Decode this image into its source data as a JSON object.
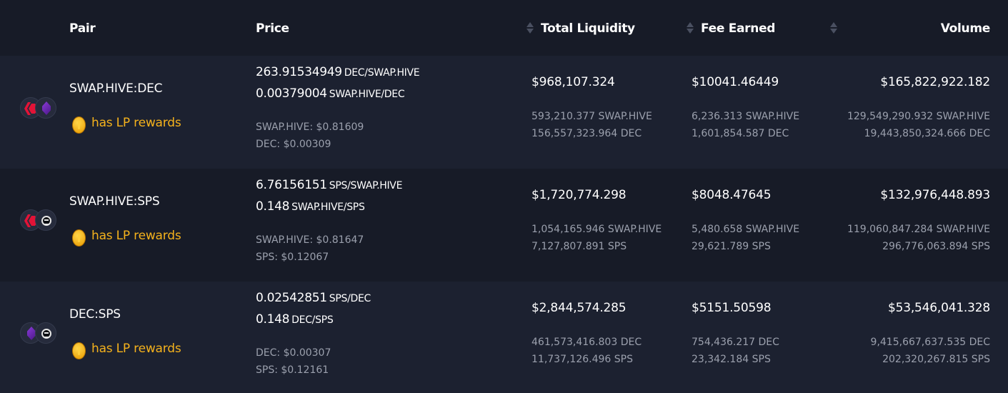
{
  "header": {
    "pair": "Pair",
    "price": "Price",
    "total_liquidity": "Total Liquidity",
    "fee_earned": "Fee Earned",
    "volume": "Volume"
  },
  "rows": [
    {
      "pair": "SWAP.HIVE:DEC",
      "icons": [
        "hive-icon",
        "dec-icon"
      ],
      "lp_rewards": "has LP rewards",
      "price1_value": "263.91534949",
      "price1_unit": "DEC/SWAP.HIVE",
      "price2_value": "0.00379004",
      "price2_unit": "SWAP.HIVE/DEC",
      "usd1": "SWAP.HIVE: $0.81609",
      "usd2": "DEC: $0.00309",
      "liquidity": "$968,107.324",
      "liquidity_a": "593,210.377 SWAP.HIVE",
      "liquidity_b": "156,557,323.964 DEC",
      "fee": "$10041.46449",
      "fee_a": "6,236.313 SWAP.HIVE",
      "fee_b": "1,601,854.587 DEC",
      "volume": "$165,822,922.182",
      "volume_a": "129,549,290.932 SWAP.HIVE",
      "volume_b": "19,443,850,324.666 DEC"
    },
    {
      "pair": "SWAP.HIVE:SPS",
      "icons": [
        "hive-icon",
        "sps-icon"
      ],
      "lp_rewards": "has LP rewards",
      "price1_value": "6.76156151",
      "price1_unit": "SPS/SWAP.HIVE",
      "price2_value": "0.148",
      "price2_unit": "SWAP.HIVE/SPS",
      "usd1": "SWAP.HIVE: $0.81647",
      "usd2": "SPS: $0.12067",
      "liquidity": "$1,720,774.298",
      "liquidity_a": "1,054,165.946 SWAP.HIVE",
      "liquidity_b": "7,127,807.891 SPS",
      "fee": "$8048.47645",
      "fee_a": "5,480.658 SWAP.HIVE",
      "fee_b": "29,621.789 SPS",
      "volume": "$132,976,448.893",
      "volume_a": "119,060,847.284 SWAP.HIVE",
      "volume_b": "296,776,063.894 SPS"
    },
    {
      "pair": "DEC:SPS",
      "icons": [
        "dec-icon",
        "sps-icon"
      ],
      "lp_rewards": "has LP rewards",
      "price1_value": "0.02542851",
      "price1_unit": "SPS/DEC",
      "price2_value": "0.148",
      "price2_unit": "DEC/SPS",
      "usd1": "DEC: $0.00307",
      "usd2": "SPS: $0.12161",
      "liquidity": "$2,844,574.285",
      "liquidity_a": "461,573,416.803 DEC",
      "liquidity_b": "11,737,126.496 SPS",
      "fee": "$5151.50598",
      "fee_a": "754,436.217 DEC",
      "fee_b": "23,342.184 SPS",
      "volume": "$53,546,041.328",
      "volume_a": "9,415,667,637.535 DEC",
      "volume_b": "202,320,267.815 SPS"
    }
  ]
}
